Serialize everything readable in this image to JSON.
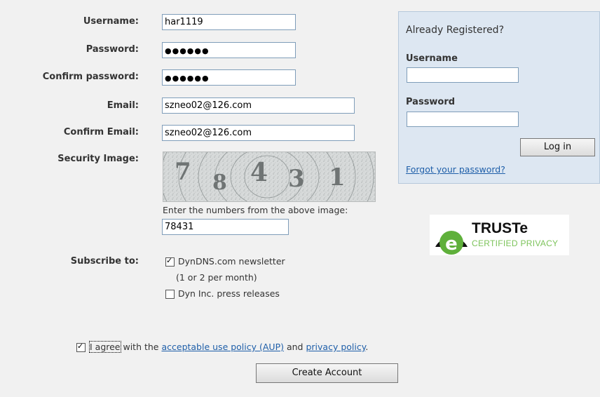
{
  "form": {
    "username_label": "Username:",
    "username_value": "har1119",
    "password_label": "Password:",
    "password_value": "●●●●●●",
    "confirm_password_label": "Confirm password:",
    "confirm_password_value": "●●●●●●",
    "email_label": "Email:",
    "email_value": "szneo02@126.com",
    "confirm_email_label": "Confirm Email:",
    "confirm_email_value": "szneo02@126.com",
    "security_label": "Security Image:",
    "captcha_digits": [
      "7",
      "8",
      "4",
      "3",
      "1"
    ],
    "captcha_instruction": "Enter the numbers from the above image:",
    "captcha_value": "78431",
    "subscribe_label": "Subscribe to:",
    "newsletter_label": "DynDNS.com newsletter",
    "newsletter_checked": true,
    "newsletter_note": "(1 or 2 per month)",
    "press_label": "Dyn Inc. press releases",
    "press_checked": false,
    "agree_prefix": "I agree",
    "agree_text_1": " with the ",
    "aup_link": "acceptable use policy (AUP)",
    "agree_text_2": " and ",
    "privacy_link": "privacy policy",
    "agree_text_3": ".",
    "agree_checked": true,
    "create_button": "Create Account"
  },
  "login": {
    "heading": "Already Registered?",
    "username_label": "Username",
    "username_value": "",
    "password_label": "Password",
    "password_value": "",
    "login_button": "Log in",
    "forgot_link": "Forgot your password?"
  },
  "truste": {
    "brand": "TRUSTe",
    "tagline": "CERTIFIED PRIVACY",
    "colors": {
      "green": "#5fb03b",
      "tagline": "#7cc35a"
    }
  }
}
